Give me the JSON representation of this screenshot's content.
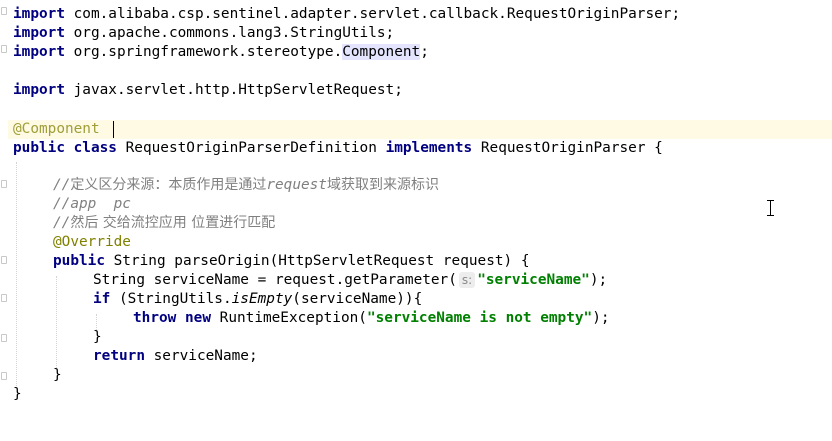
{
  "code": {
    "import1": {
      "kw": "import",
      "rest": " com.alibaba.csp.sentinel.adapter.servlet.callback.RequestOriginParser;"
    },
    "import2": {
      "kw": "import",
      "rest": " org.apache.commons.lang3.StringUtils;"
    },
    "import3": {
      "kw": "import",
      "pre": " org.springframework.stereotype.",
      "ref": "Component",
      "post": ";"
    },
    "import4": {
      "kw": "import",
      "rest": " javax.servlet.http.HttpServletRequest;"
    },
    "annotation_component": "@Component",
    "class_decl": {
      "kw1": "public class",
      "name": " RequestOriginParserDefinition ",
      "kw2": "implements",
      "iface": " RequestOriginParser {"
    },
    "comment1": {
      "slashes": "//",
      "text_cn1": "定义区分来源：本质作用是通过",
      "text_mono": "request",
      "text_cn2": "域获取到来源标识"
    },
    "comment2": "//app  pc",
    "comment3": {
      "slashes": "//",
      "text_cn": "然后 交给流控应用 位置进行匹配"
    },
    "annotation_override": "@Override",
    "method_decl": {
      "kw": "public",
      "rest": " String parseOrigin(HttpServletRequest request) {"
    },
    "stmt1": {
      "pre": "String serviceName = request.getParameter(",
      "hint": "s:",
      "str": "\"serviceName\"",
      "post": ");"
    },
    "stmt2": {
      "kw": "if",
      "pre": " (StringUtils.",
      "italic": "isEmpty",
      "post": "(serviceName)){"
    },
    "stmt3": {
      "kw1": "throw",
      "kw2": "new",
      "mid": " RuntimeException(",
      "str": "\"serviceName is not empty\"",
      "post": ");"
    },
    "close_if": "}",
    "stmt4": {
      "kw": "return",
      "rest": " serviceName;"
    },
    "close_method": "}",
    "close_class": "}"
  },
  "icons": {
    "cursor": "text-cursor-icon",
    "fold": "fold-marker-icon"
  }
}
